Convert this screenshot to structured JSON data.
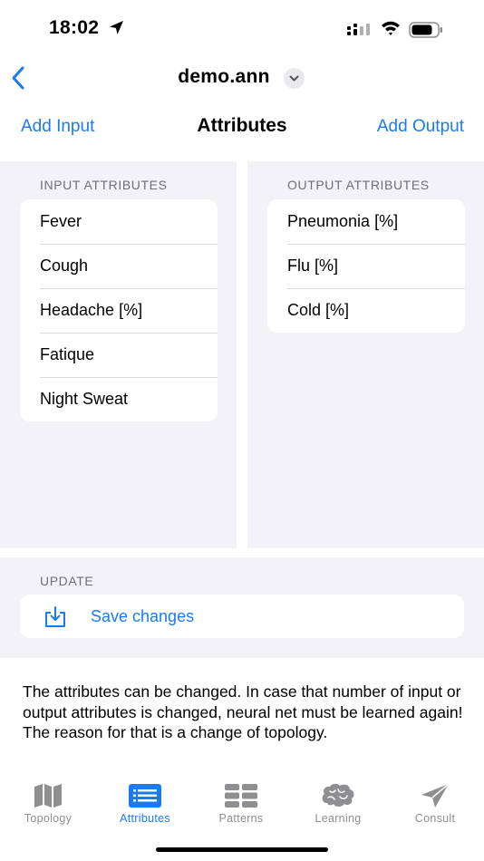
{
  "status": {
    "time": "18:02"
  },
  "nav": {
    "document_title": "demo.ann"
  },
  "toolbar": {
    "add_input": "Add Input",
    "title": "Attributes",
    "add_output": "Add Output"
  },
  "inputs": {
    "header": "INPUT ATTRIBUTES",
    "items": [
      "Fever",
      "Cough",
      "Headache [%]",
      "Fatique",
      "Night Sweat"
    ]
  },
  "outputs": {
    "header": "OUTPUT ATTRIBUTES",
    "items": [
      "Pneumonia [%]",
      "Flu [%]",
      "Cold [%]"
    ]
  },
  "update": {
    "header": "UPDATE",
    "save_label": "Save changes"
  },
  "info_text": "The attributes can be changed. In case that number of input or output attributes is changed, neural net must be learned again! The reason for that is a change of topology.",
  "tabs": [
    {
      "label": "Topology",
      "icon": "map-icon"
    },
    {
      "label": "Attributes",
      "icon": "list-icon"
    },
    {
      "label": "Patterns",
      "icon": "table-icon"
    },
    {
      "label": "Learning",
      "icon": "brain-icon"
    },
    {
      "label": "Consult",
      "icon": "paperplane-icon"
    }
  ],
  "colors": {
    "accent": "#1a7bf0",
    "inactive": "#8e8e93",
    "group_background": "#f2f2f7"
  }
}
